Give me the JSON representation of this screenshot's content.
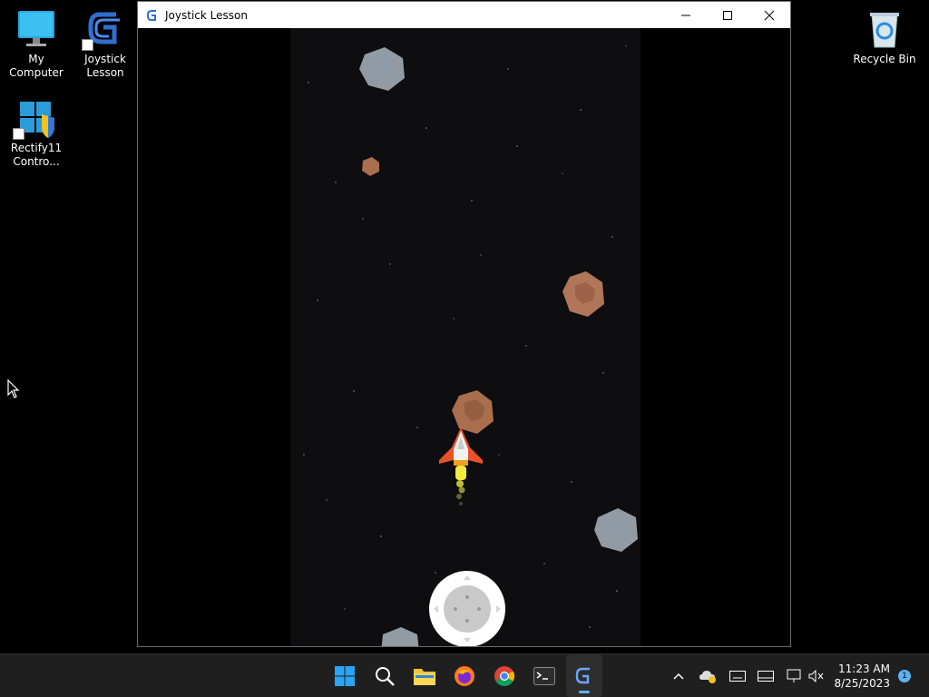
{
  "desktop": {
    "icons": [
      {
        "label": "My Computer"
      },
      {
        "label": "Joystick Lesson"
      },
      {
        "label": "Rectify11 Contro..."
      },
      {
        "label": "Recycle Bin"
      }
    ]
  },
  "window": {
    "title": "Joystick Lesson",
    "controls": [
      "minimize",
      "maximize",
      "close"
    ]
  },
  "game": {
    "asteroids": [
      {
        "kind": "gray"
      },
      {
        "kind": "brown"
      },
      {
        "kind": "brown"
      },
      {
        "kind": "brown"
      },
      {
        "kind": "gray"
      },
      {
        "kind": "gray"
      }
    ],
    "player": "spaceship",
    "joystick": "virtual-joystick"
  },
  "taskbar": {
    "apps": [
      "start",
      "search",
      "file-explorer",
      "firefox",
      "chrome",
      "terminal",
      "joystick-lesson"
    ],
    "active_app": "joystick-lesson",
    "clock": {
      "time": "11:23 AM",
      "date": "8/25/2023"
    },
    "notification_count": "1"
  },
  "colors": {
    "playfield": "#0e0d0f",
    "taskbar": "#1f1f1f",
    "accent": "#5fb2f2"
  }
}
